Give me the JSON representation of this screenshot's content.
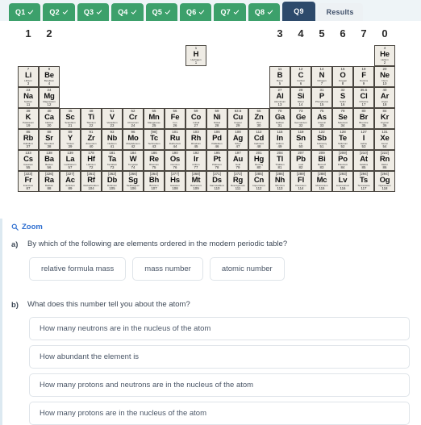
{
  "tabs": [
    {
      "label": "Q1",
      "state": "done"
    },
    {
      "label": "Q2",
      "state": "done"
    },
    {
      "label": "Q3",
      "state": "done"
    },
    {
      "label": "Q4",
      "state": "done"
    },
    {
      "label": "Q5",
      "state": "done"
    },
    {
      "label": "Q6",
      "state": "done"
    },
    {
      "label": "Q7",
      "state": "done"
    },
    {
      "label": "Q8",
      "state": "done"
    },
    {
      "label": "Q9",
      "state": "current"
    },
    {
      "label": "Results",
      "state": "results"
    }
  ],
  "colors": {
    "tab_done": "#3ca06b",
    "tab_current": "#2d4a6b",
    "tab_results": "#edf1f4",
    "tabbar_bg": "#eef4f7",
    "link": "#2f6fd0",
    "cell_bg": "#efece5",
    "cell_border": "#4a4640",
    "option_border": "#dfe4e9",
    "text": "#3d4856"
  },
  "periodic_table": {
    "group_numbers": [
      {
        "label": "1",
        "col": 1
      },
      {
        "label": "2",
        "col": 2
      },
      {
        "label": "3",
        "col": 13
      },
      {
        "label": "4",
        "col": 14
      },
      {
        "label": "5",
        "col": 15
      },
      {
        "label": "6",
        "col": 16
      },
      {
        "label": "7",
        "col": 17
      },
      {
        "label": "0",
        "col": 18
      }
    ],
    "elements": [
      {
        "mass": "1",
        "sym": "H",
        "name": "Hydrogen",
        "z": "1",
        "row": 1,
        "col": 9
      },
      {
        "mass": "4",
        "sym": "He",
        "name": "Helium",
        "z": "2",
        "row": 1,
        "col": 18
      },
      {
        "mass": "7",
        "sym": "Li",
        "name": "Lithium",
        "z": "3",
        "row": 2,
        "col": 1
      },
      {
        "mass": "9",
        "sym": "Be",
        "name": "Beryllium",
        "z": "4",
        "row": 2,
        "col": 2
      },
      {
        "mass": "11",
        "sym": "B",
        "name": "Boron",
        "z": "5",
        "row": 2,
        "col": 13
      },
      {
        "mass": "12",
        "sym": "C",
        "name": "Carbon",
        "z": "6",
        "row": 2,
        "col": 14
      },
      {
        "mass": "14",
        "sym": "N",
        "name": "Nitrogen",
        "z": "7",
        "row": 2,
        "col": 15
      },
      {
        "mass": "16",
        "sym": "O",
        "name": "Oxygen",
        "z": "8",
        "row": 2,
        "col": 16
      },
      {
        "mass": "19",
        "sym": "F",
        "name": "Fluorine",
        "z": "9",
        "row": 2,
        "col": 17
      },
      {
        "mass": "20",
        "sym": "Ne",
        "name": "Neon",
        "z": "10",
        "row": 2,
        "col": 18
      },
      {
        "mass": "23",
        "sym": "Na",
        "name": "Sodium",
        "z": "11",
        "row": 3,
        "col": 1
      },
      {
        "mass": "24",
        "sym": "Mg",
        "name": "Magnesium",
        "z": "12",
        "row": 3,
        "col": 2
      },
      {
        "mass": "27",
        "sym": "Al",
        "name": "Aluminium",
        "z": "13",
        "row": 3,
        "col": 13
      },
      {
        "mass": "28",
        "sym": "Si",
        "name": "Silicon",
        "z": "14",
        "row": 3,
        "col": 14
      },
      {
        "mass": "31",
        "sym": "P",
        "name": "Phosphorus",
        "z": "15",
        "row": 3,
        "col": 15
      },
      {
        "mass": "32",
        "sym": "S",
        "name": "Sulfur",
        "z": "16",
        "row": 3,
        "col": 16
      },
      {
        "mass": "35.5",
        "sym": "Cl",
        "name": "Chlorine",
        "z": "17",
        "row": 3,
        "col": 17
      },
      {
        "mass": "40",
        "sym": "Ar",
        "name": "Argon",
        "z": "18",
        "row": 3,
        "col": 18
      },
      {
        "mass": "39",
        "sym": "K",
        "name": "Potassium",
        "z": "19",
        "row": 4,
        "col": 1
      },
      {
        "mass": "40",
        "sym": "Ca",
        "name": "Calcium",
        "z": "20",
        "row": 4,
        "col": 2
      },
      {
        "mass": "45",
        "sym": "Sc",
        "name": "Scandium",
        "z": "21",
        "row": 4,
        "col": 3
      },
      {
        "mass": "48",
        "sym": "Ti",
        "name": "Titanium",
        "z": "22",
        "row": 4,
        "col": 4
      },
      {
        "mass": "51",
        "sym": "V",
        "name": "Vanadium",
        "z": "23",
        "row": 4,
        "col": 5
      },
      {
        "mass": "52",
        "sym": "Cr",
        "name": "Chromium",
        "z": "24",
        "row": 4,
        "col": 6
      },
      {
        "mass": "55",
        "sym": "Mn",
        "name": "Manganese",
        "z": "25",
        "row": 4,
        "col": 7
      },
      {
        "mass": "56",
        "sym": "Fe",
        "name": "Iron",
        "z": "26",
        "row": 4,
        "col": 8
      },
      {
        "mass": "59",
        "sym": "Co",
        "name": "Cobalt",
        "z": "27",
        "row": 4,
        "col": 9
      },
      {
        "mass": "59",
        "sym": "Ni",
        "name": "Nickel",
        "z": "28",
        "row": 4,
        "col": 10
      },
      {
        "mass": "63.5",
        "sym": "Cu",
        "name": "Copper",
        "z": "29",
        "row": 4,
        "col": 11
      },
      {
        "mass": "65",
        "sym": "Zn",
        "name": "Zinc",
        "z": "30",
        "row": 4,
        "col": 12
      },
      {
        "mass": "70",
        "sym": "Ga",
        "name": "Gallium",
        "z": "31",
        "row": 4,
        "col": 13
      },
      {
        "mass": "73",
        "sym": "Ge",
        "name": "Germanium",
        "z": "32",
        "row": 4,
        "col": 14
      },
      {
        "mass": "75",
        "sym": "As",
        "name": "Arsenic",
        "z": "33",
        "row": 4,
        "col": 15
      },
      {
        "mass": "79",
        "sym": "Se",
        "name": "Selenium",
        "z": "34",
        "row": 4,
        "col": 16
      },
      {
        "mass": "80",
        "sym": "Br",
        "name": "Bromine",
        "z": "35",
        "row": 4,
        "col": 17
      },
      {
        "mass": "84",
        "sym": "Kr",
        "name": "Krypton",
        "z": "36",
        "row": 4,
        "col": 18
      },
      {
        "mass": "85",
        "sym": "Rb",
        "name": "Rubidium",
        "z": "37",
        "row": 5,
        "col": 1
      },
      {
        "mass": "88",
        "sym": "Sr",
        "name": "Strontium",
        "z": "38",
        "row": 5,
        "col": 2
      },
      {
        "mass": "89",
        "sym": "Y",
        "name": "Yttrium",
        "z": "39",
        "row": 5,
        "col": 3
      },
      {
        "mass": "91",
        "sym": "Zr",
        "name": "Zirconium",
        "z": "40",
        "row": 5,
        "col": 4
      },
      {
        "mass": "93",
        "sym": "Nb",
        "name": "Niobium",
        "z": "41",
        "row": 5,
        "col": 5
      },
      {
        "mass": "96",
        "sym": "Mo",
        "name": "Molybdenum",
        "z": "42",
        "row": 5,
        "col": 6
      },
      {
        "mass": "[98]",
        "sym": "Tc",
        "name": "Technetium",
        "z": "43",
        "row": 5,
        "col": 7
      },
      {
        "mass": "101",
        "sym": "Ru",
        "name": "Ruthenium",
        "z": "44",
        "row": 5,
        "col": 8
      },
      {
        "mass": "103",
        "sym": "Rh",
        "name": "Rhodium",
        "z": "45",
        "row": 5,
        "col": 9
      },
      {
        "mass": "106",
        "sym": "Pd",
        "name": "Palladium",
        "z": "46",
        "row": 5,
        "col": 10
      },
      {
        "mass": "108",
        "sym": "Ag",
        "name": "Silver",
        "z": "47",
        "row": 5,
        "col": 11
      },
      {
        "mass": "112",
        "sym": "Cd",
        "name": "Cadmium",
        "z": "48",
        "row": 5,
        "col": 12
      },
      {
        "mass": "115",
        "sym": "In",
        "name": "Indium",
        "z": "49",
        "row": 5,
        "col": 13
      },
      {
        "mass": "119",
        "sym": "Sn",
        "name": "Tin",
        "z": "50",
        "row": 5,
        "col": 14
      },
      {
        "mass": "122",
        "sym": "Sb",
        "name": "Antimony",
        "z": "51",
        "row": 5,
        "col": 15
      },
      {
        "mass": "128",
        "sym": "Te",
        "name": "Tellurium",
        "z": "52",
        "row": 5,
        "col": 16
      },
      {
        "mass": "127",
        "sym": "I",
        "name": "Iodine",
        "z": "53",
        "row": 5,
        "col": 17
      },
      {
        "mass": "131",
        "sym": "Xe",
        "name": "Xenon",
        "z": "54",
        "row": 5,
        "col": 18
      },
      {
        "mass": "133",
        "sym": "Cs",
        "name": "Caesium",
        "z": "55",
        "row": 6,
        "col": 1
      },
      {
        "mass": "138",
        "sym": "Ba",
        "name": "Barium",
        "z": "56",
        "row": 6,
        "col": 2
      },
      {
        "mass": "139",
        "sym": "La",
        "name": "Lanthanum",
        "z": "57",
        "row": 6,
        "col": 3
      },
      {
        "mass": "178",
        "sym": "Hf",
        "name": "Hafnium",
        "z": "72",
        "row": 6,
        "col": 4
      },
      {
        "mass": "181",
        "sym": "Ta",
        "name": "Tantalum",
        "z": "73",
        "row": 6,
        "col": 5
      },
      {
        "mass": "184",
        "sym": "W",
        "name": "Tungsten",
        "z": "74",
        "row": 6,
        "col": 6
      },
      {
        "mass": "186",
        "sym": "Re",
        "name": "Rhenium",
        "z": "75",
        "row": 6,
        "col": 7
      },
      {
        "mass": "190",
        "sym": "Os",
        "name": "Osmium",
        "z": "76",
        "row": 6,
        "col": 8
      },
      {
        "mass": "192",
        "sym": "Ir",
        "name": "Iridium",
        "z": "77",
        "row": 6,
        "col": 9
      },
      {
        "mass": "195",
        "sym": "Pt",
        "name": "Platinum",
        "z": "78",
        "row": 6,
        "col": 10
      },
      {
        "mass": "197",
        "sym": "Au",
        "name": "Gold",
        "z": "79",
        "row": 6,
        "col": 11
      },
      {
        "mass": "201",
        "sym": "Hg",
        "name": "Mercury",
        "z": "80",
        "row": 6,
        "col": 12
      },
      {
        "mass": "204",
        "sym": "Tl",
        "name": "Thallium",
        "z": "81",
        "row": 6,
        "col": 13
      },
      {
        "mass": "207",
        "sym": "Pb",
        "name": "Lead",
        "z": "82",
        "row": 6,
        "col": 14
      },
      {
        "mass": "209",
        "sym": "Bi",
        "name": "Bismuth",
        "z": "83",
        "row": 6,
        "col": 15
      },
      {
        "mass": "[209]",
        "sym": "Po",
        "name": "Polonium",
        "z": "84",
        "row": 6,
        "col": 16
      },
      {
        "mass": "[210]",
        "sym": "At",
        "name": "Astatine",
        "z": "85",
        "row": 6,
        "col": 17
      },
      {
        "mass": "[222]",
        "sym": "Rn",
        "name": "Radon",
        "z": "86",
        "row": 6,
        "col": 18
      },
      {
        "mass": "[223]",
        "sym": "Fr",
        "name": "Francium",
        "z": "87",
        "row": 7,
        "col": 1
      },
      {
        "mass": "[226]",
        "sym": "Ra",
        "name": "Radium",
        "z": "88",
        "row": 7,
        "col": 2
      },
      {
        "mass": "[227]",
        "sym": "Ac",
        "name": "Actinium",
        "z": "89",
        "row": 7,
        "col": 3
      },
      {
        "mass": "[261]",
        "sym": "Rf",
        "name": "Rutherfordium",
        "z": "104",
        "row": 7,
        "col": 4
      },
      {
        "mass": "[262]",
        "sym": "Db",
        "name": "Dubnium",
        "z": "105",
        "row": 7,
        "col": 5
      },
      {
        "mass": "[266]",
        "sym": "Sg",
        "name": "Seaborgium",
        "z": "106",
        "row": 7,
        "col": 6
      },
      {
        "mass": "[264]",
        "sym": "Bh",
        "name": "Bohrium",
        "z": "107",
        "row": 7,
        "col": 7
      },
      {
        "mass": "[277]",
        "sym": "Hs",
        "name": "Hassium",
        "z": "108",
        "row": 7,
        "col": 8
      },
      {
        "mass": "[268]",
        "sym": "Mt",
        "name": "Meitnerium",
        "z": "109",
        "row": 7,
        "col": 9
      },
      {
        "mass": "[271]",
        "sym": "Ds",
        "name": "Darmstadtium",
        "z": "110",
        "row": 7,
        "col": 10
      },
      {
        "mass": "[272]",
        "sym": "Rg",
        "name": "Roentgenium",
        "z": "111",
        "row": 7,
        "col": 11
      },
      {
        "mass": "[285]",
        "sym": "Cn",
        "name": "Copernicium",
        "z": "112",
        "row": 7,
        "col": 12
      },
      {
        "mass": "[286]",
        "sym": "Nh",
        "name": "Nihonium",
        "z": "113",
        "row": 7,
        "col": 13
      },
      {
        "mass": "[289]",
        "sym": "Fl",
        "name": "Flerovium",
        "z": "114",
        "row": 7,
        "col": 14
      },
      {
        "mass": "[288]",
        "sym": "Mc",
        "name": "Moscovium",
        "z": "115",
        "row": 7,
        "col": 15
      },
      {
        "mass": "[293]",
        "sym": "Lv",
        "name": "Livermorium",
        "z": "116",
        "row": 7,
        "col": 16
      },
      {
        "mass": "[294]",
        "sym": "Ts",
        "name": "Tennessine",
        "z": "117",
        "row": 7,
        "col": 17
      },
      {
        "mass": "[294]",
        "sym": "Og",
        "name": "Oganesson",
        "z": "118",
        "row": 7,
        "col": 18
      }
    ]
  },
  "zoom_link": {
    "label": "Zoom"
  },
  "question_a": {
    "marker": "a)",
    "text": "By which of the following are elements ordered in the modern periodic table?",
    "options": [
      "relative formula mass",
      "mass number",
      "atomic number"
    ]
  },
  "question_b": {
    "marker": "b)",
    "text": "What does this number tell you about the atom?",
    "options": [
      "How many neutrons are in the nucleus of the atom",
      "How abundant the element is",
      "How many protons and neutrons are in the nucleus of the atom",
      "How many protons are in the nucleus of the atom"
    ]
  }
}
